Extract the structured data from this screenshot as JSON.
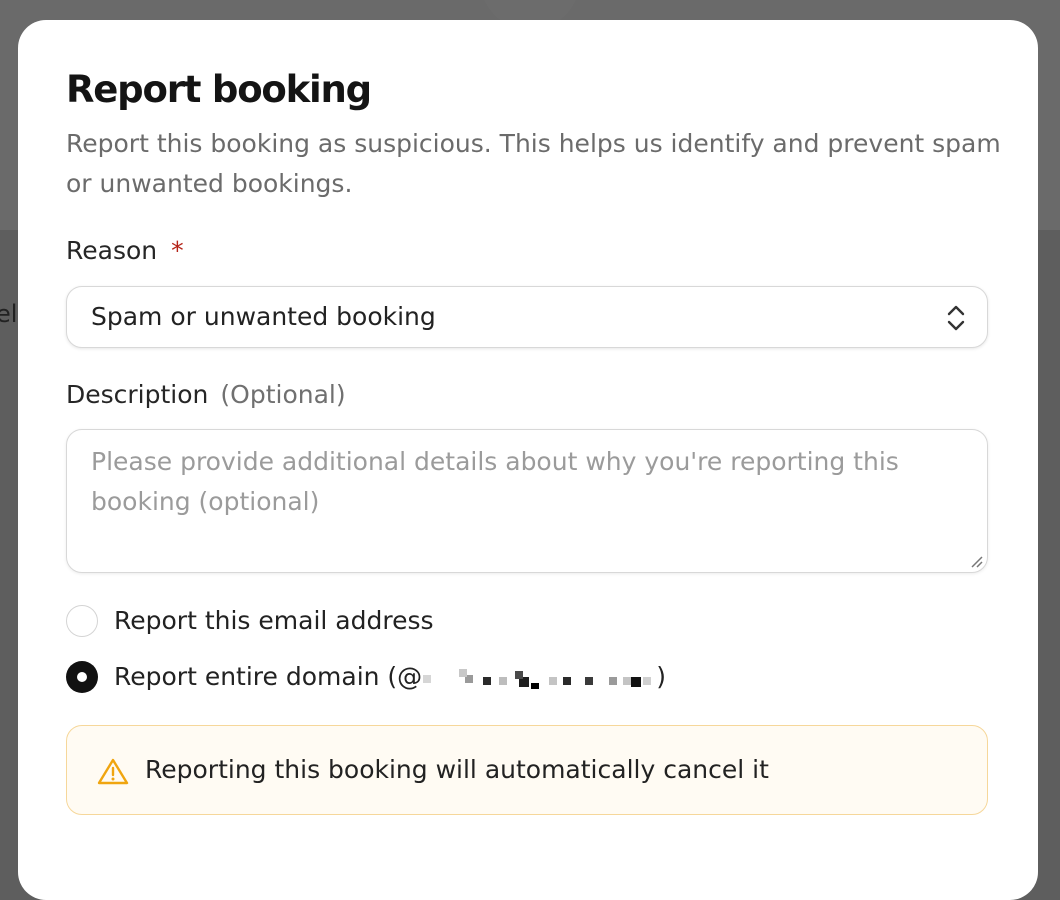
{
  "backdrop": {
    "partial_text": "ell"
  },
  "dialog": {
    "title": "Report booking",
    "subtitle": "Report this booking as suspicious. This helps us identify and prevent spam or unwanted bookings.",
    "reason": {
      "label": "Reason",
      "required_marker": "*",
      "selected_value": "Spam or unwanted booking",
      "icon": "chevron-up-down-icon"
    },
    "description": {
      "label": "Description",
      "hint": "(Optional)",
      "value": "",
      "placeholder": "Please provide additional details about why you're reporting this booking (optional)"
    },
    "report_scope": {
      "selected": "domain",
      "options": [
        {
          "id": "email",
          "label": "Report this email address",
          "selected": false
        },
        {
          "id": "domain",
          "label_prefix": "Report entire domain (@",
          "label_suffix": ")",
          "selected": true
        }
      ]
    },
    "warning": {
      "text": "Reporting this booking will automatically cancel it",
      "icon": "warning-triangle-icon",
      "accent_color": "#f0a50f"
    }
  }
}
